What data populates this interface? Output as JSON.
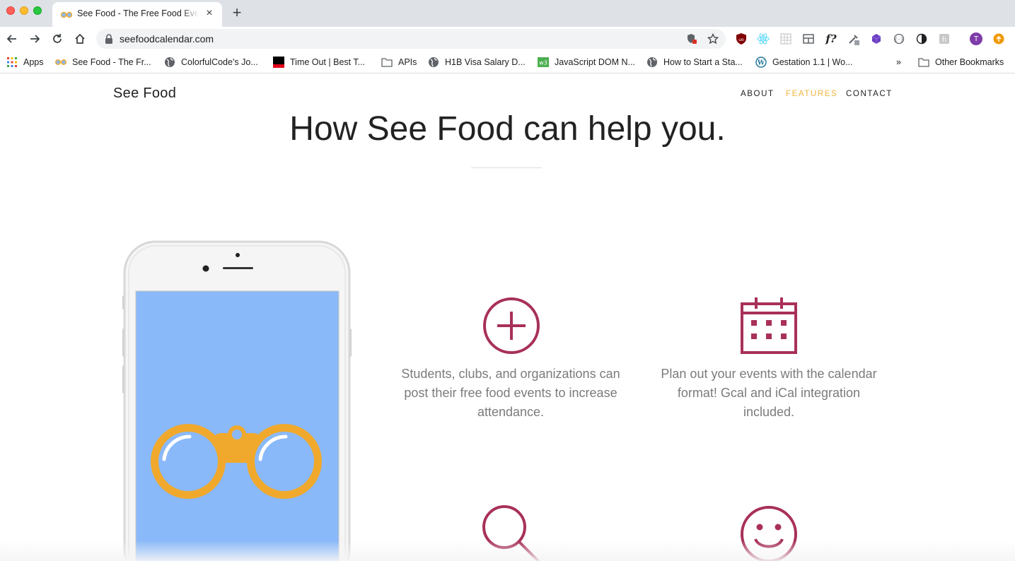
{
  "browser": {
    "tab_title": "See Food - The Free Food Events Calendar",
    "url": "seefoodcalendar.com",
    "profile_initial": "T",
    "bookmarks": [
      {
        "label": "Apps",
        "icon": "apps-grid-icon"
      },
      {
        "label": "See Food - The Fr...",
        "icon": "binoculars-icon"
      },
      {
        "label": "ColorfulCode's Jo...",
        "icon": "globe-icon"
      },
      {
        "label": "Time Out | Best T...",
        "icon": "timeout-icon"
      },
      {
        "label": "APIs",
        "icon": "folder-icon"
      },
      {
        "label": "H1B Visa Salary D...",
        "icon": "globe-icon"
      },
      {
        "label": "JavaScript DOM N...",
        "icon": "w3schools-icon"
      },
      {
        "label": "How to Start a Sta...",
        "icon": "globe-icon"
      },
      {
        "label": "Gestation 1.1 | Wo...",
        "icon": "wordpress-icon"
      }
    ],
    "more_bookmarks": "»",
    "other_bookmarks": "Other Bookmarks"
  },
  "site": {
    "brand": "See Food",
    "nav": {
      "about": "ABOUT",
      "features": "FEATURES",
      "contact": "CONTACT"
    },
    "headline": "How See Food can help you.",
    "features": [
      {
        "icon": "plus-circle-icon",
        "text": "Students, clubs, and organizations can post their free food events to increase attendance."
      },
      {
        "icon": "calendar-icon",
        "text": "Plan out your events with the calendar format! Gcal and iCal integration included."
      },
      {
        "icon": "magnifier-icon",
        "text": ""
      },
      {
        "icon": "smiley-icon",
        "text": ""
      }
    ]
  },
  "colors": {
    "accent": "#f0b33e",
    "icon": "#a8305a",
    "phone_screen": "#8ab9f9",
    "binoculars": "#f0a92c"
  }
}
